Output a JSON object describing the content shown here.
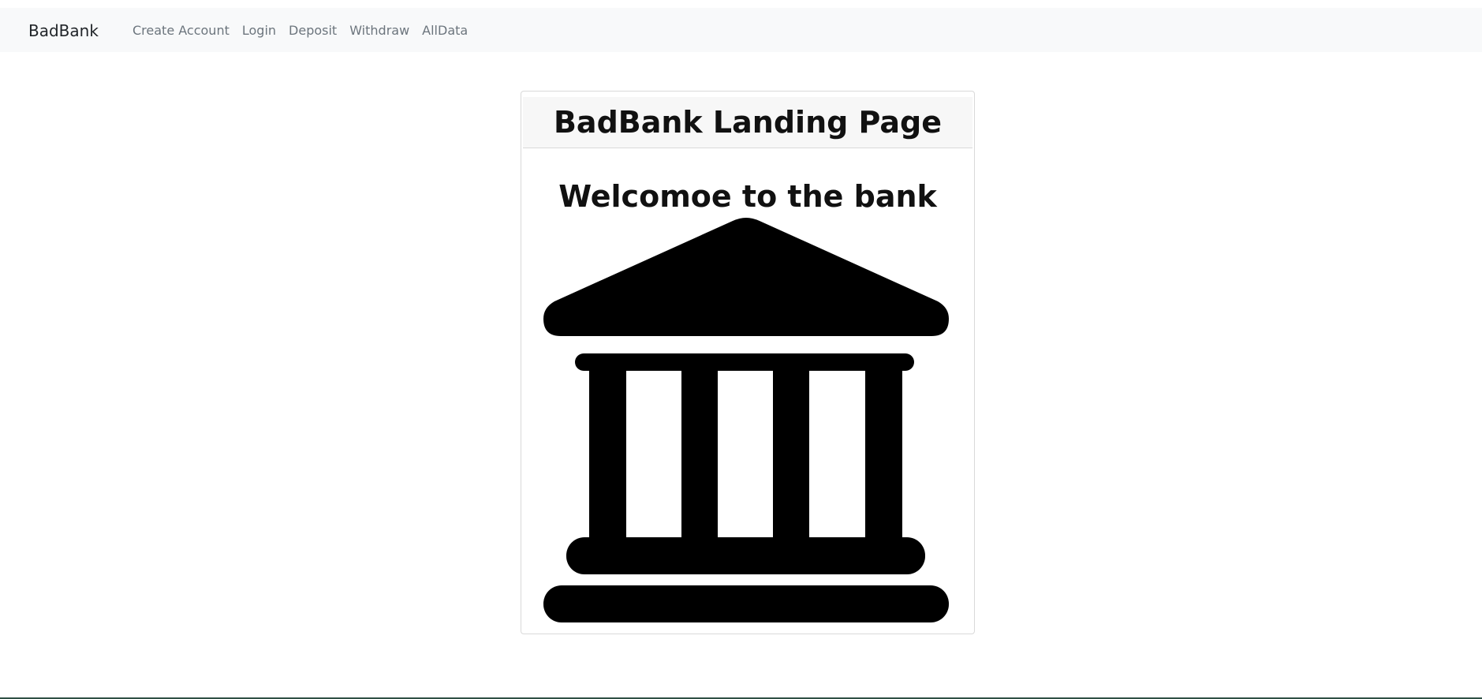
{
  "navbar": {
    "brand": "BadBank",
    "links": [
      {
        "label": "Create Account"
      },
      {
        "label": "Login"
      },
      {
        "label": "Deposit"
      },
      {
        "label": "Withdraw"
      },
      {
        "label": "AllData"
      }
    ]
  },
  "card": {
    "header": "BadBank Landing Page",
    "welcome": "Welcomoe to the bank",
    "icon": "bank-building-icon"
  },
  "colors": {
    "navbar_bg": "#f8f9fa",
    "nav_link": "#6c757d",
    "brand_text": "#212529",
    "card_header_bg": "#f7f7f7",
    "card_border": "#d9d9d9",
    "icon_fill": "#000000"
  }
}
